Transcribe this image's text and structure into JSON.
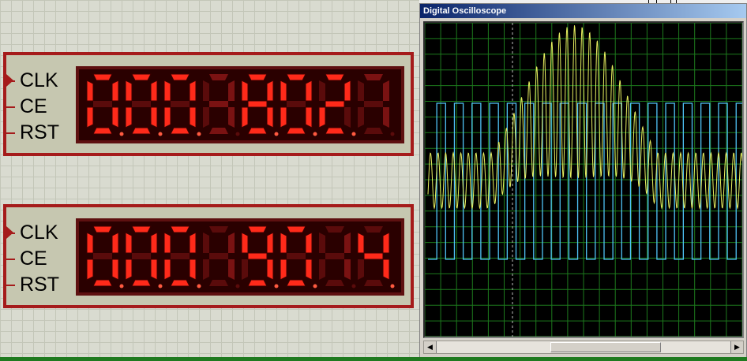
{
  "counters": [
    {
      "pins": [
        "CLK",
        "CE",
        "RST"
      ],
      "digits": [
        "0",
        "0",
        "0",
        "3",
        "8",
        "0",
        "2",
        "7"
      ],
      "lit": [
        true,
        true,
        true,
        false,
        true,
        true,
        true,
        false
      ]
    },
    {
      "pins": [
        "CLK",
        "CE",
        "RST"
      ],
      "digits": [
        "0",
        "0",
        "0",
        "1",
        "9",
        "0",
        "1",
        "4"
      ],
      "lit": [
        true,
        true,
        true,
        false,
        true,
        true,
        false,
        true
      ]
    }
  ],
  "oscilloscope": {
    "title": "Digital Oscilloscope",
    "channels": [
      {
        "name": "square",
        "color": "#4fc3f7"
      },
      {
        "name": "am-signal",
        "color": "#e8f060"
      }
    ],
    "grid_color": "#1d7a1d",
    "scroll_left_icon": "arrow-left-icon",
    "scroll_right_icon": "arrow-right-icon"
  },
  "colors": {
    "segment_on": "#ff2a1a",
    "segment_off": "#5a0b0b",
    "frame_red": "#a51b1b"
  }
}
